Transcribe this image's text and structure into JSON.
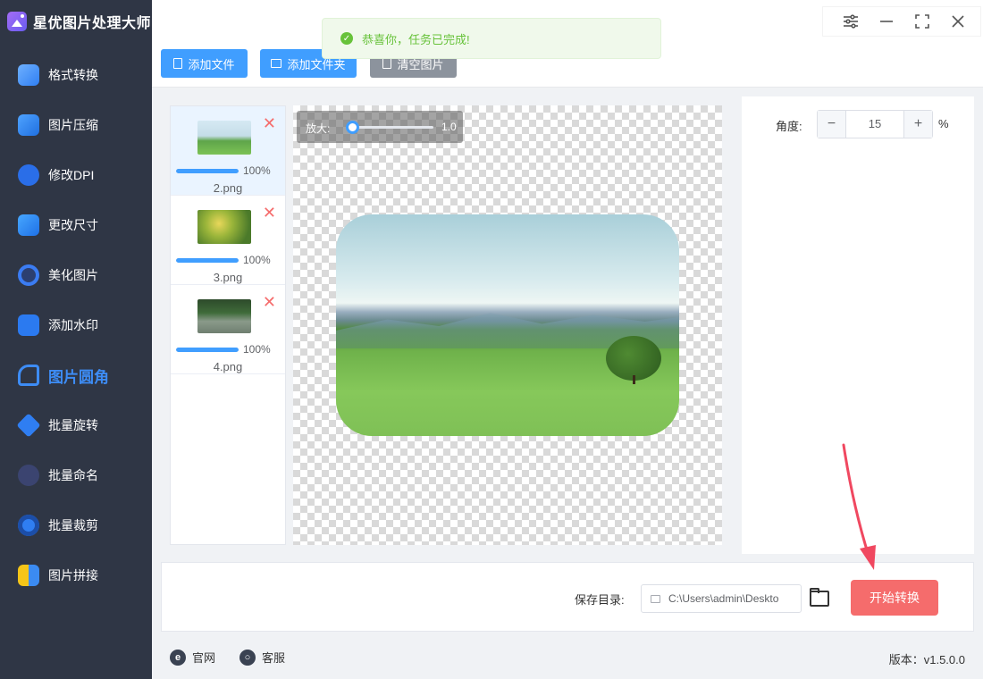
{
  "app": {
    "title": "星优图片处理大师"
  },
  "sidebar": {
    "items": [
      {
        "label": "格式转换",
        "icon": "image-convert-icon"
      },
      {
        "label": "图片压缩",
        "icon": "image-compress-icon"
      },
      {
        "label": "修改DPI",
        "icon": "dpi-icon"
      },
      {
        "label": "更改尺寸",
        "icon": "resize-icon"
      },
      {
        "label": "美化图片",
        "icon": "beautify-icon"
      },
      {
        "label": "添加水印",
        "icon": "watermark-icon"
      },
      {
        "label": "图片圆角",
        "icon": "rounded-corner-icon",
        "active": true
      },
      {
        "label": "批量旋转",
        "icon": "rotate-icon"
      },
      {
        "label": "批量命名",
        "icon": "rename-icon"
      },
      {
        "label": "批量裁剪",
        "icon": "crop-icon"
      },
      {
        "label": "图片拼接",
        "icon": "stitch-icon"
      }
    ]
  },
  "toolbar": {
    "add_file": "添加文件",
    "add_folder": "添加文件夹",
    "clear": "清空图片"
  },
  "toast": {
    "message": "恭喜你，任务已完成!",
    "type": "success"
  },
  "files": [
    {
      "name": "2.png",
      "progress": "100%",
      "progress_value": 1.0
    },
    {
      "name": "3.png",
      "progress": "100%",
      "progress_value": 1.0
    },
    {
      "name": "4.png",
      "progress": "100%",
      "progress_value": 1.0
    }
  ],
  "zoom": {
    "label": "放大:",
    "value": "1.0",
    "level": 0.0
  },
  "settings": {
    "angle_label": "角度:",
    "angle_value": "15",
    "unit": "%"
  },
  "output": {
    "save_label": "保存目录:",
    "path": "C:\\Users\\admin\\Deskto",
    "start": "开始转换"
  },
  "footer": {
    "website": "官网",
    "service": "客服",
    "version": "版本：v1.5.0.0"
  },
  "colors": {
    "sidebar_bg": "#2f3645",
    "accent": "#409eff",
    "active_text": "#3d8cf5",
    "danger": "#f56c6c",
    "success": "#67c23a",
    "arrow": "#f04860"
  }
}
